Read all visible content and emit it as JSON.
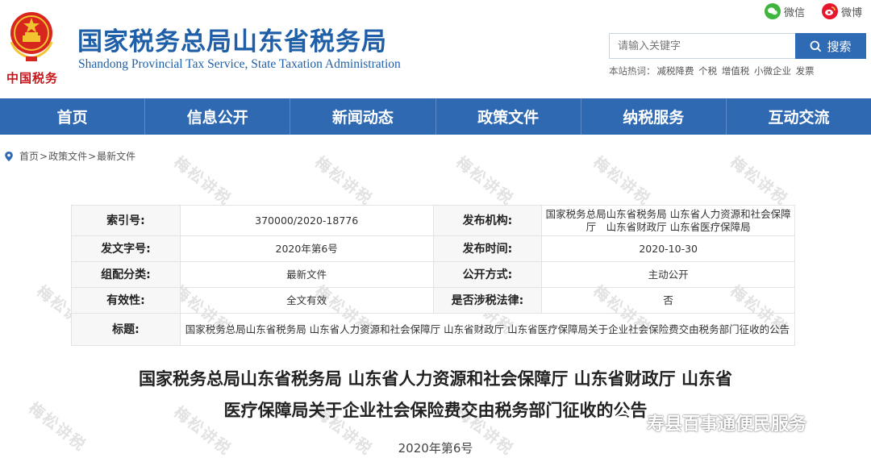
{
  "header": {
    "emblem_text": "中国税务",
    "title": "国家税务总局山东省税务局",
    "subtitle": "Shandong Provincial Tax Service, State Taxation Administration",
    "social": [
      {
        "label": "微信",
        "icon": "wechat-icon",
        "color": "#3fb53d"
      },
      {
        "label": "微博",
        "icon": "weibo-icon",
        "color": "#e6162d"
      }
    ],
    "search": {
      "placeholder": "请输入关键字",
      "button_label": "搜索"
    },
    "hot_label": "本站热词：",
    "hot_words": [
      "减税降费",
      "个税",
      "增值税",
      "小微企业",
      "发票"
    ]
  },
  "nav": {
    "items": [
      "首页",
      "信息公开",
      "新闻动态",
      "政策文件",
      "纳税服务",
      "互动交流"
    ],
    "color": "#2f69b2"
  },
  "breadcrumb": {
    "items": [
      "首页",
      "政策文件",
      "最新文件"
    ],
    "separator": ">"
  },
  "info_table": {
    "index_label": "索引号:",
    "index_value": "370000/2020-18776",
    "publisher_label": "发布机构:",
    "publisher_value": "国家税务总局山东省税务局 山东省人力资源和社会保障厅　山东省财政厅 山东省医疗保障局",
    "doc_no_label": "发文字号:",
    "doc_no_value": "2020年第6号",
    "pub_date_label": "发布时间:",
    "pub_date_value": "2020-10-30",
    "category_label": "组配分类:",
    "category_value": "最新文件",
    "open_mode_label": "公开方式:",
    "open_mode_value": "主动公开",
    "validity_label": "有效性:",
    "validity_value": "全文有效",
    "tax_law_label": "是否涉税法律:",
    "tax_law_value": "否",
    "title_label": "标题:",
    "title_value": "国家税务总局山东省税务局 山东省人力资源和社会保障厅 山东省财政厅 山东省医疗保障局关于企业社会保险费交由税务部门征收的公告"
  },
  "article": {
    "title_line1": "国家税务总局山东省税务局 山东省人力资源和社会保障厅 山东省财政厅 山东省",
    "title_line2": "医疗保障局关于企业社会保险费交由税务部门征收的公告",
    "doc_number": "2020年第6号"
  },
  "watermark": {
    "text": "梅松讲税",
    "brand": "寿县百事通便民服务"
  }
}
